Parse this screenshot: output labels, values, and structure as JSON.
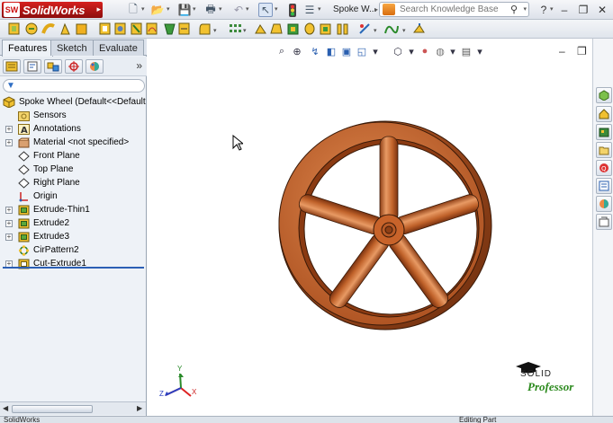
{
  "app": {
    "name": "SolidWorks",
    "badge": "SW",
    "document_title": "Spoke W...",
    "search_placeholder": "Search Knowledge Base"
  },
  "feature_manager": {
    "tabs": [
      {
        "label": "Features",
        "active": true
      },
      {
        "label": "Sketch",
        "active": false
      },
      {
        "label": "Evaluate",
        "active": false
      }
    ],
    "panel_icons": [
      "feature-tree-icon",
      "property-manager-icon",
      "configuration-manager-icon",
      "dimxpert-icon",
      "display-manager-icon"
    ],
    "tree": [
      {
        "label": "Spoke Wheel  (Default<<Default",
        "icon": "part-icon",
        "expandable": false
      },
      {
        "label": "Sensors",
        "icon": "sensors-folder-icon",
        "expandable": false
      },
      {
        "label": "Annotations",
        "icon": "annotations-icon",
        "expandable": true
      },
      {
        "label": "Material <not specified>",
        "icon": "material-icon",
        "expandable": true
      },
      {
        "label": "Front Plane",
        "icon": "plane-icon",
        "expandable": false
      },
      {
        "label": "Top Plane",
        "icon": "plane-icon",
        "expandable": false
      },
      {
        "label": "Right Plane",
        "icon": "plane-icon",
        "expandable": false
      },
      {
        "label": "Origin",
        "icon": "origin-icon",
        "expandable": false
      },
      {
        "label": "Extrude-Thin1",
        "icon": "extrude-icon",
        "expandable": true
      },
      {
        "label": "Extrude2",
        "icon": "extrude-icon",
        "expandable": true
      },
      {
        "label": "Extrude3",
        "icon": "extrude-icon",
        "expandable": true
      },
      {
        "label": "CirPattern2",
        "icon": "circular-pattern-icon",
        "expandable": false
      },
      {
        "label": "Cut-Extrude1",
        "icon": "cut-extrude-icon",
        "expandable": true
      }
    ]
  },
  "triad": {
    "x_label": "X",
    "y_label": "Y",
    "z_label": "Z"
  },
  "watermark": {
    "top": "SOLID",
    "bottom": "Professor"
  },
  "status_bar": {
    "left": "SolidWorks",
    "right": "Editing Part"
  },
  "colors": {
    "wheel": "#c8632a",
    "wheel_dark": "#8e3f16",
    "wheel_light": "#e8915a",
    "accent_red": "#c8201d",
    "tree_rollback": "#2b5fb5",
    "watermark_green": "#2c8a1e"
  }
}
